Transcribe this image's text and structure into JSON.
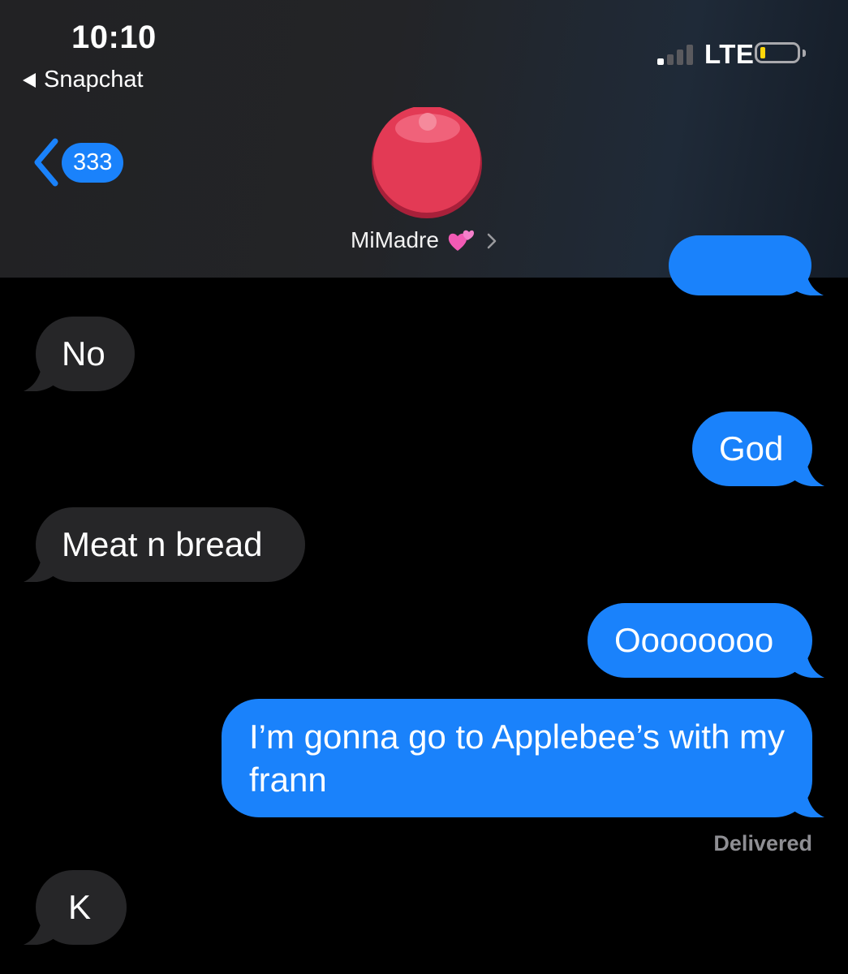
{
  "status_bar": {
    "time": "10:10",
    "back_app": "Snapchat",
    "network": "LTE",
    "signal_bars": 1,
    "battery_level": 0.08
  },
  "nav": {
    "unread_count": "333",
    "contact_name": "MiMadre"
  },
  "colors": {
    "sent_bubble": "#1a82fb",
    "received_bubble": "#262628",
    "battery_low": "#ffd60a",
    "avatar": "#e33a55"
  },
  "messages": [
    {
      "direction": "received",
      "text": "No"
    },
    {
      "direction": "sent",
      "text": "God"
    },
    {
      "direction": "received",
      "text": "Meat n bread"
    },
    {
      "direction": "sent",
      "text": "Oooooooo"
    },
    {
      "direction": "sent",
      "text": "I’m gonna go to Applebee’s with my frann"
    },
    {
      "direction": "received",
      "text": "K"
    }
  ],
  "delivery_status": "Delivered"
}
